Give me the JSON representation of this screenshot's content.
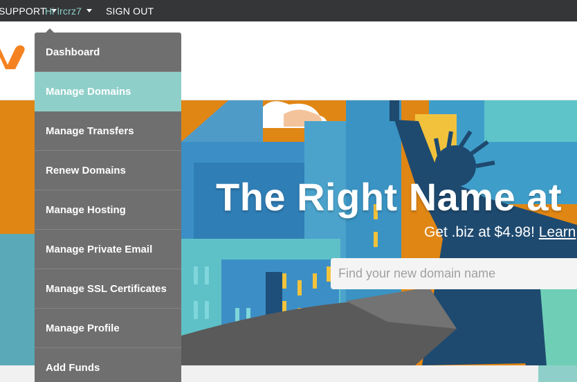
{
  "topnav": {
    "support_label": "SUPPORT",
    "user_label": "Hi lrcrz7",
    "signout_label": "SIGN OUT"
  },
  "dropdown": {
    "items": [
      {
        "label": "Dashboard",
        "active": false
      },
      {
        "label": "Manage Domains",
        "active": true
      },
      {
        "label": "Manage Transfers",
        "active": false
      },
      {
        "label": "Renew Domains",
        "active": false
      },
      {
        "label": "Manage Hosting",
        "active": false
      },
      {
        "label": "Manage Private Email",
        "active": false
      },
      {
        "label": "Manage SSL Certificates",
        "active": false
      },
      {
        "label": "Manage Profile",
        "active": false
      },
      {
        "label": "Add Funds",
        "active": false
      }
    ]
  },
  "hero": {
    "title": "The Right Name at",
    "subtitle_text": "Get .biz at $4.98! ",
    "subtitle_link": "Learn",
    "search_placeholder": "Find your new domain name"
  },
  "colors": {
    "topbar": "#343638",
    "dropdown": "#706f6f",
    "accent_teal": "#8fcfc9",
    "logo_orange": "#f58220",
    "hero_orange": "#e08614",
    "hero_blue": "#2e8fc4"
  }
}
